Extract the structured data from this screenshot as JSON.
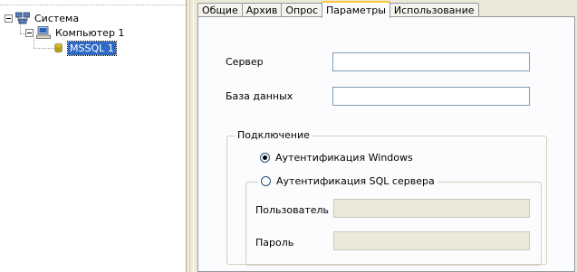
{
  "tree": {
    "root": {
      "label": "Система"
    },
    "computer": {
      "label": "Компьютер 1"
    },
    "instance": {
      "label": "MSSQL 1"
    }
  },
  "tabs": [
    {
      "label": "Общие"
    },
    {
      "label": "Архив"
    },
    {
      "label": "Опрос"
    },
    {
      "label": "Параметры"
    },
    {
      "label": "Использование"
    }
  ],
  "active_tab": "Параметры",
  "params": {
    "server_label": "Сервер",
    "server_value": "",
    "database_label": "База данных",
    "database_value": "",
    "connection_group": "Подключение",
    "auth_windows": "Аутентификация Windows",
    "auth_sql": "Аутентификация SQL сервера",
    "user_label": "Пользователь",
    "user_value": "",
    "password_label": "Пароль",
    "password_value": ""
  },
  "colors": {
    "selection": "#316ac5",
    "active_tab_highlight": "#ffc83c",
    "window_bg": "#ece9d8"
  }
}
